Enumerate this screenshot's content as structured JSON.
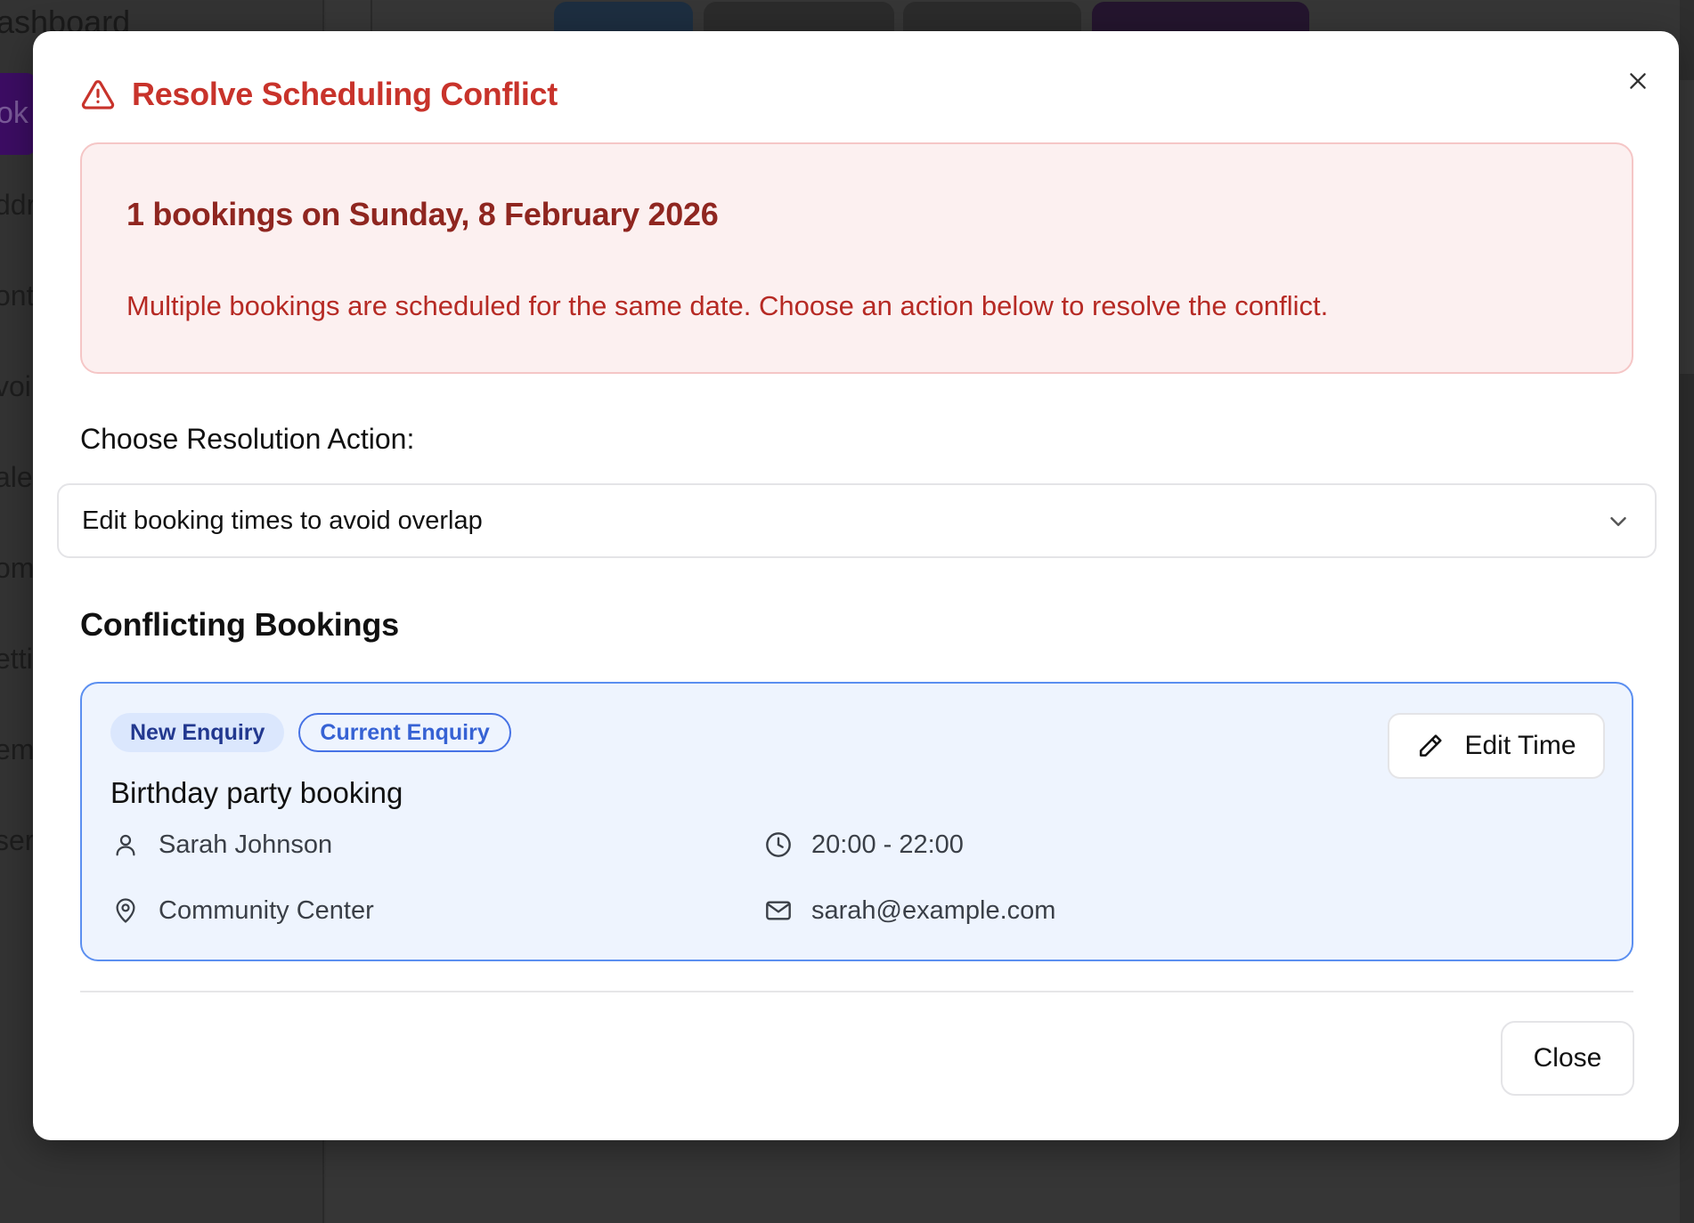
{
  "background": {
    "sidebar_title": "ashboard",
    "sidebar_active_fragment": "ok",
    "sidebar_fragments": [
      "ddr",
      "ont",
      "voi",
      "ale",
      "om",
      "etti",
      "emp",
      "ser"
    ]
  },
  "modal": {
    "title": "Resolve Scheduling Conflict",
    "close_icon": "close-icon",
    "alert": {
      "heading": "1 bookings on Sunday, 8 February 2026",
      "text": "Multiple bookings are scheduled for the same date. Choose an action below to resolve the conflict."
    },
    "resolution": {
      "label": "Choose Resolution Action:",
      "selected": "Edit booking times to avoid overlap"
    },
    "conflicts": {
      "heading": "Conflicting Bookings",
      "bookings": [
        {
          "badges": [
            "New Enquiry",
            "Current Enquiry"
          ],
          "title": "Birthday party booking",
          "contact_name": "Sarah Johnson",
          "time": "20:00 - 22:00",
          "location": "Community Center",
          "email": "sarah@example.com",
          "edit_label": "Edit Time"
        }
      ]
    },
    "footer": {
      "close_label": "Close"
    }
  },
  "colors": {
    "danger": "#c8332b",
    "alert_bg": "#fcf0f0",
    "card_bg": "#eef4fe",
    "card_border": "#5b8ff0"
  }
}
